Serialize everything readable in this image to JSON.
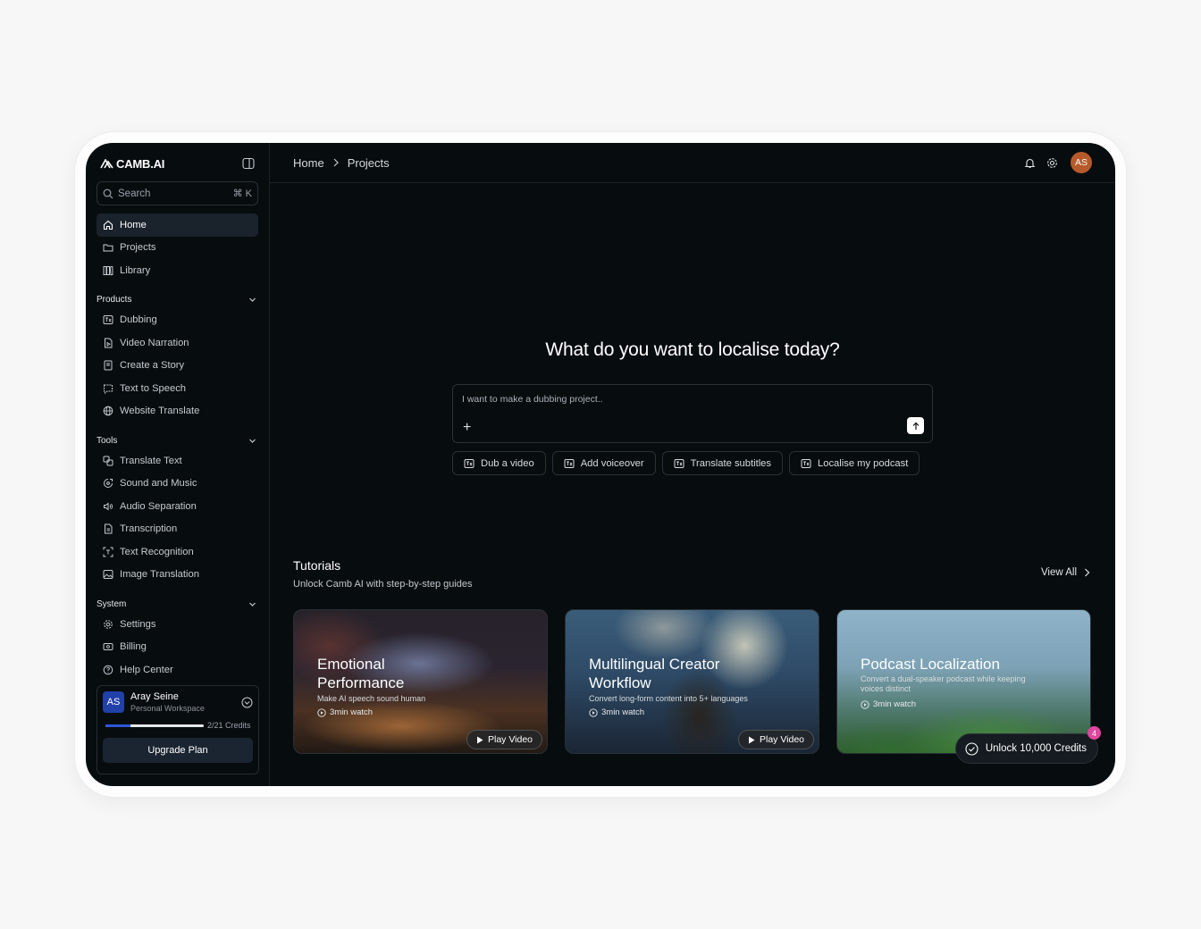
{
  "app": {
    "brand": "CAMB.AI"
  },
  "search": {
    "placeholder": "Search",
    "shortcut": "⌘ K"
  },
  "nav": [
    {
      "label": "Home",
      "icon": "home-icon"
    },
    {
      "label": "Projects",
      "icon": "folder-icon"
    },
    {
      "label": "Library",
      "icon": "library-icon"
    }
  ],
  "sections": {
    "products": {
      "title": "Products",
      "items": [
        {
          "label": "Dubbing",
          "icon": "dubbing-icon"
        },
        {
          "label": "Video Narration",
          "icon": "video-narration-icon"
        },
        {
          "label": "Create a Story",
          "icon": "story-icon"
        },
        {
          "label": "Text to Speech",
          "icon": "tts-icon"
        },
        {
          "label": "Website Translate",
          "icon": "globe-icon"
        }
      ]
    },
    "tools": {
      "title": "Tools",
      "items": [
        {
          "label": "Translate Text",
          "icon": "translate-icon"
        },
        {
          "label": "Sound and Music",
          "icon": "music-icon"
        },
        {
          "label": "Audio Separation",
          "icon": "audio-icon"
        },
        {
          "label": "Transcription",
          "icon": "transcription-icon"
        },
        {
          "label": "Text Recognition",
          "icon": "scan-text-icon"
        },
        {
          "label": "Image Translation",
          "icon": "image-icon"
        }
      ]
    },
    "system": {
      "title": "System",
      "items": [
        {
          "label": "Settings",
          "icon": "gear-icon"
        },
        {
          "label": "Billing",
          "icon": "billing-icon"
        },
        {
          "label": "Help Center",
          "icon": "help-icon"
        }
      ]
    }
  },
  "profile": {
    "initials": "AS",
    "name": "Aray Seine",
    "workspace": "Personal Workspace",
    "credits_text": "2/21 Credits",
    "credits_fraction": 0.25,
    "upgrade_label": "Upgrade Plan"
  },
  "topbar": {
    "breadcrumb": [
      "Home",
      "Projects"
    ],
    "avatar_initials": "AS"
  },
  "hero": {
    "title": "What do you want to localise today?",
    "prompt_placeholder": "I want to make a dubbing project..",
    "chips": [
      "Dub a video",
      "Add voiceover",
      "Translate subtitles",
      "Localise my podcast"
    ]
  },
  "tutorials": {
    "title": "Tutorials",
    "subtitle": "Unlock Camb AI with step-by-step guides",
    "view_all": "View All",
    "cards": [
      {
        "title_l1": "Emotional",
        "title_l2": "Performance",
        "desc_l1": "Make AI speech sound human",
        "desc_l2": "",
        "watch": "3min watch",
        "play": "Play Video"
      },
      {
        "title_l1": "Multilingual Creator",
        "title_l2": "Workflow",
        "desc_l1": "Convert long-form content into 5+ languages",
        "desc_l2": "",
        "watch": "3min watch",
        "play": "Play Video"
      },
      {
        "title_l1": "Podcast Localization",
        "title_l2": "",
        "desc_l1": "Convert a dual-speaker podcast while keeping",
        "desc_l2": "voices distinct",
        "watch": "3min watch",
        "play": ""
      }
    ]
  },
  "unlock": {
    "label": "Unlock 10,000 Credits",
    "badge": "4"
  },
  "colors": {
    "accent": "#2f56d8",
    "avatar": "#b65a2a",
    "badge": "#e0459d",
    "background": "#070c0f"
  }
}
